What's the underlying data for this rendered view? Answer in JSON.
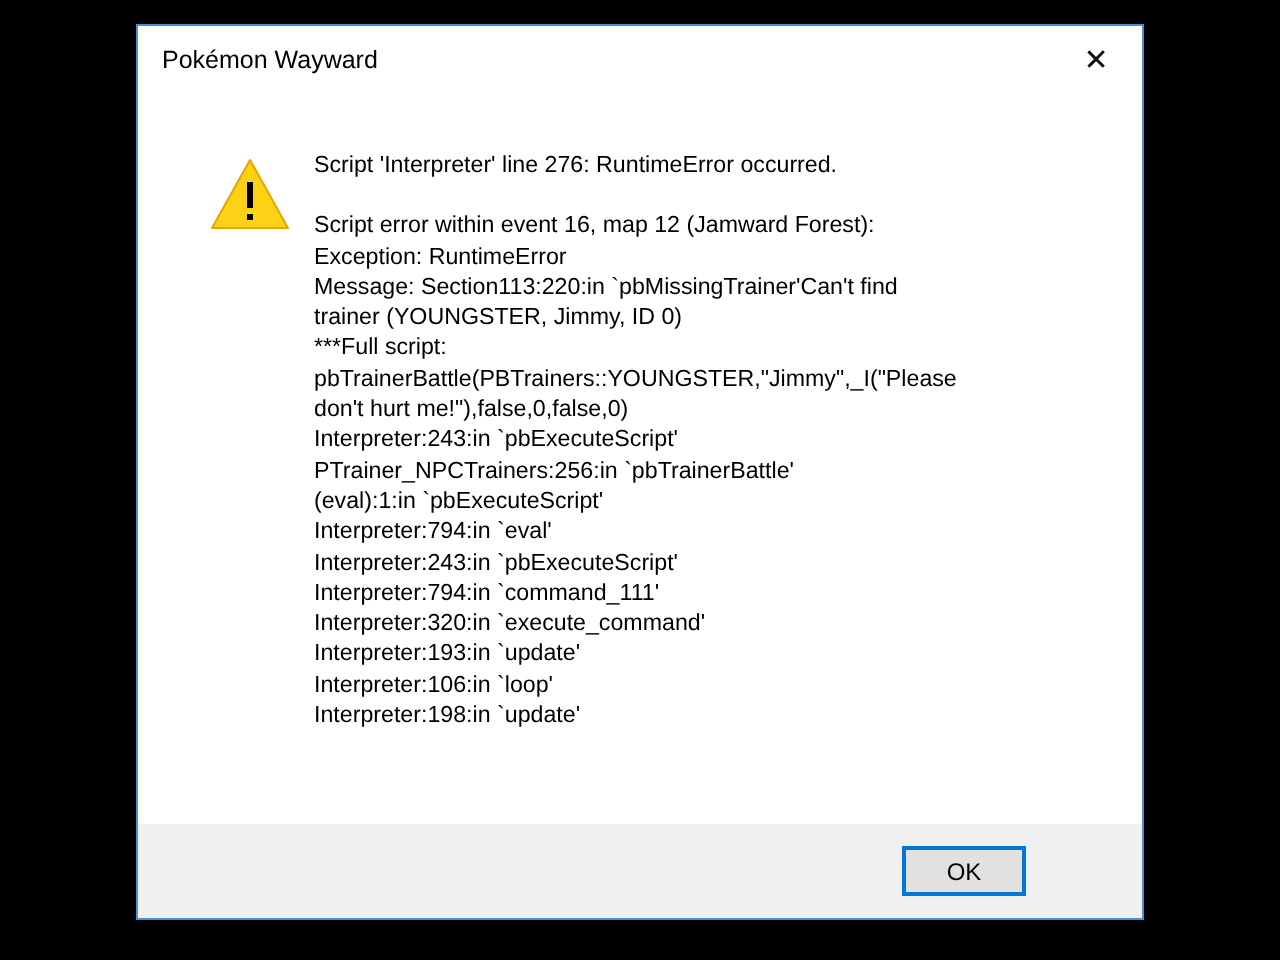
{
  "window": {
    "title": "Pokémon Wayward",
    "close": "✕"
  },
  "message": {
    "kind": "warning",
    "heading": "Script 'Interpreter' line 276: RuntimeError occurred.",
    "lines": [
      "Script error within event 16, map 12 (Jamward Forest):",
      "Exception: RuntimeError",
      "Message: Section113:220:in `pbMissingTrainer'Can't find",
      "trainer (YOUNGSTER, Jimmy, ID 0)",
      "***Full script:",
      "pbTrainerBattle(PBTrainers::YOUNGSTER,\"Jimmy\",_I(\"Please",
      "don't hurt me!\"),false,0,false,0)",
      "Interpreter:243:in `pbExecuteScript'",
      "PTrainer_NPCTrainers:256:in `pbTrainerBattle'",
      "(eval):1:in `pbExecuteScript'",
      "Interpreter:794:in `eval'",
      "Interpreter:243:in `pbExecuteScript'",
      "Interpreter:794:in `command_111'",
      "Interpreter:320:in `execute_command'",
      "Interpreter:193:in `update'",
      "Interpreter:106:in `loop'",
      "Interpreter:198:in `update'"
    ]
  },
  "buttons": [
    {
      "label": "OK",
      "selected": true
    }
  ]
}
